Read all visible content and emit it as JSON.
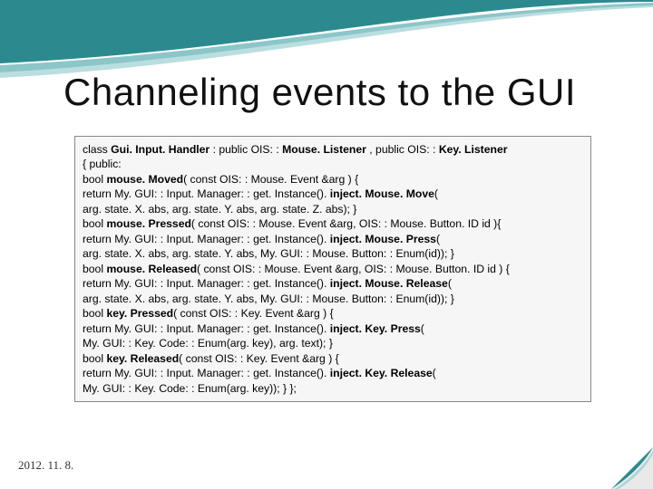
{
  "title": "Channeling events to the GUI",
  "date": "2012. 11. 8.",
  "code": {
    "l1a": "class ",
    "l1b": "Gui. Input. Handler ",
    "l1c": ": public OIS: : ",
    "l1d": "Mouse. Listener ",
    "l1e": ", public OIS: : ",
    "l1f": "Key. Listener",
    "l2": "{ public:",
    "l3a": "bool ",
    "l3b": "mouse. Moved",
    "l3c": "( const OIS: : Mouse. Event &arg ) {",
    "l4a": "return My. GUI: : Input. Manager: : get. Instance(). ",
    "l4b": "inject. Mouse. Move",
    "l4c": "(",
    "l5": "arg. state. X. abs, arg. state. Y. abs, arg. state. Z. abs); }",
    "l6a": "bool ",
    "l6b": "mouse. Pressed",
    "l6c": "( const OIS: : Mouse. Event &arg, OIS: : Mouse. Button. ID id ){",
    "l7a": "return My. GUI: : Input. Manager: : get. Instance(). ",
    "l7b": "inject. Mouse. Press",
    "l7c": "(",
    "l8": "arg. state. X. abs, arg. state. Y. abs, My. GUI: : Mouse. Button: : Enum(id)); }",
    "l9a": "bool ",
    "l9b": "mouse. Released",
    "l9c": "( const OIS: : Mouse. Event &arg, OIS: : Mouse. Button. ID id ) {",
    "l10a": "return My. GUI: : Input. Manager: : get. Instance(). ",
    "l10b": "inject. Mouse. Release",
    "l10c": "(",
    "l11": "arg. state. X. abs, arg. state. Y. abs, My. GUI: : Mouse. Button: : Enum(id)); }",
    "l12a": "bool ",
    "l12b": "key. Pressed",
    "l12c": "( const OIS: : Key. Event &arg ) {",
    "l13a": "return My. GUI: : Input. Manager: : get. Instance(). ",
    "l13b": "inject. Key. Press",
    "l13c": "(",
    "l14": "My. GUI: : Key. Code: : Enum(arg. key), arg. text); }",
    "l15a": "bool ",
    "l15b": "key. Released",
    "l15c": "( const OIS: : Key. Event &arg ) {",
    "l16a": "return My. GUI: : Input. Manager: : get. Instance(). ",
    "l16b": "inject. Key. Release",
    "l16c": "(",
    "l17": "My. GUI: : Key. Code: : Enum(arg. key)); } };"
  }
}
